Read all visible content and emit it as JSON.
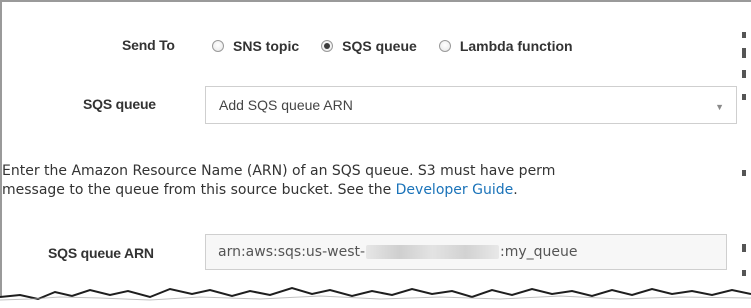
{
  "send_to": {
    "label": "Send To",
    "options": [
      {
        "label": "SNS topic",
        "selected": false
      },
      {
        "label": "SQS queue",
        "selected": true
      },
      {
        "label": "Lambda function",
        "selected": false
      }
    ]
  },
  "sqs_queue": {
    "label": "SQS queue",
    "selected_value": "Add SQS queue ARN"
  },
  "help": {
    "line1": "Enter the Amazon Resource Name (ARN) of an SQS queue. S3 must have perm",
    "line2_prefix": "message to the queue from this source bucket. See the ",
    "link_text": "Developer Guide",
    "line2_suffix": "."
  },
  "sqs_arn": {
    "label": "SQS queue ARN",
    "value_prefix": "arn:aws:sqs:us-west-",
    "value_suffix": ":my_queue"
  }
}
